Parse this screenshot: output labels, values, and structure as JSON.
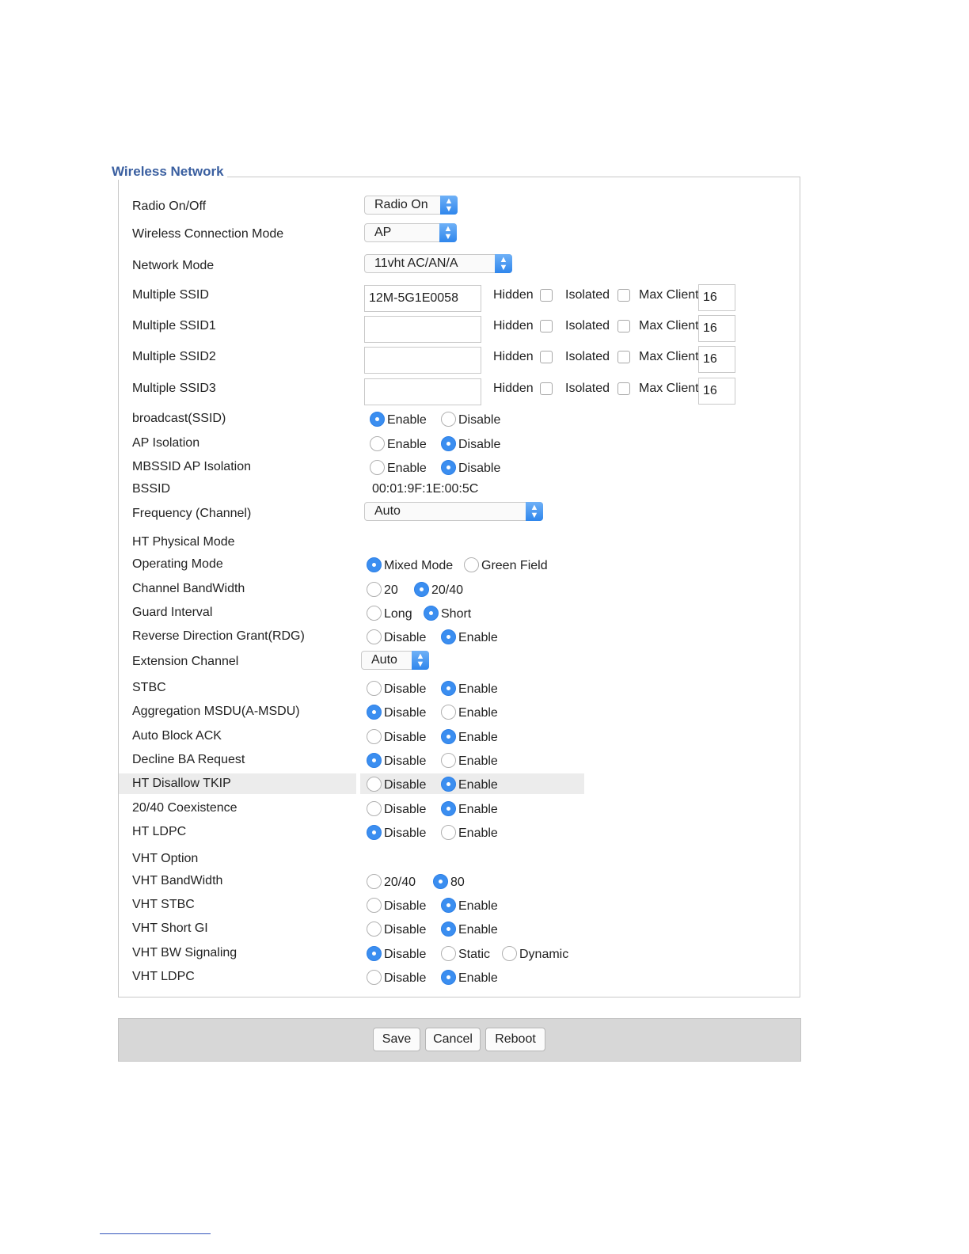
{
  "title": "Wireless Network",
  "radio_onoff": {
    "label": "Radio On/Off",
    "value": "Radio On"
  },
  "connection_mode": {
    "label": "Wireless Connection Mode",
    "value": "AP"
  },
  "network_mode": {
    "label": "Network Mode",
    "value": "11vht AC/AN/A"
  },
  "ssid_common": {
    "hidden": "Hidden",
    "isolated": "Isolated",
    "max_client": "Max Client"
  },
  "ssids": [
    {
      "label": "Multiple SSID",
      "value": "12M-5G1E0058",
      "max": "16"
    },
    {
      "label": "Multiple SSID1",
      "value": "",
      "max": "16"
    },
    {
      "label": "Multiple SSID2",
      "value": "",
      "max": "16"
    },
    {
      "label": "Multiple SSID3",
      "value": "",
      "max": "16"
    }
  ],
  "broadcast": {
    "label": "broadcast(SSID)",
    "opt1": "Enable",
    "opt2": "Disable",
    "selected": 1
  },
  "ap_isolation": {
    "label": "AP Isolation",
    "opt1": "Enable",
    "opt2": "Disable",
    "selected": 2
  },
  "mbssid_isolation": {
    "label": "MBSSID AP Isolation",
    "opt1": "Enable",
    "opt2": "Disable",
    "selected": 2
  },
  "bssid": {
    "label": "BSSID",
    "value": "00:01:9F:1E:00:5C"
  },
  "frequency": {
    "label": "Frequency (Channel)",
    "value": "Auto"
  },
  "ht_section": "HT Physical Mode",
  "operating_mode": {
    "label": "Operating Mode",
    "opt1": "Mixed Mode",
    "opt2": "Green Field",
    "selected": 1
  },
  "channel_bw": {
    "label": "Channel BandWidth",
    "opt1": "20",
    "opt2": "20/40",
    "selected": 2
  },
  "guard_interval": {
    "label": "Guard Interval",
    "opt1": "Long",
    "opt2": "Short",
    "selected": 2
  },
  "rdg": {
    "label": "Reverse Direction Grant(RDG)",
    "opt1": "Disable",
    "opt2": "Enable",
    "selected": 2
  },
  "extension_channel": {
    "label": "Extension Channel",
    "value": "Auto"
  },
  "stbc": {
    "label": "STBC",
    "opt1": "Disable",
    "opt2": "Enable",
    "selected": 2
  },
  "amsdu": {
    "label": "Aggregation MSDU(A-MSDU)",
    "opt1": "Disable",
    "opt2": "Enable",
    "selected": 1
  },
  "auto_block_ack": {
    "label": "Auto Block ACK",
    "opt1": "Disable",
    "opt2": "Enable",
    "selected": 2
  },
  "decline_ba": {
    "label": "Decline BA Request",
    "opt1": "Disable",
    "opt2": "Enable",
    "selected": 1
  },
  "ht_disallow_tkip": {
    "label": "HT Disallow TKIP",
    "opt1": "Disable",
    "opt2": "Enable",
    "selected": 2
  },
  "coexistence": {
    "label": "20/40 Coexistence",
    "opt1": "Disable",
    "opt2": "Enable",
    "selected": 2
  },
  "ht_ldpc": {
    "label": "HT LDPC",
    "opt1": "Disable",
    "opt2": "Enable",
    "selected": 1
  },
  "vht_section": "VHT Option",
  "vht_bw": {
    "label": "VHT BandWidth",
    "opt1": "20/40",
    "opt2": "80",
    "selected": 2
  },
  "vht_stbc": {
    "label": "VHT STBC",
    "opt1": "Disable",
    "opt2": "Enable",
    "selected": 2
  },
  "vht_short_gi": {
    "label": "VHT Short GI",
    "opt1": "Disable",
    "opt2": "Enable",
    "selected": 2
  },
  "vht_bw_signaling": {
    "label": "VHT BW Signaling",
    "opt1": "Disable",
    "opt2": "Static",
    "opt3": "Dynamic",
    "selected": 1
  },
  "vht_ldpc": {
    "label": "VHT LDPC",
    "opt1": "Disable",
    "opt2": "Enable",
    "selected": 2
  },
  "buttons": {
    "save": "Save",
    "cancel": "Cancel",
    "reboot": "Reboot"
  }
}
